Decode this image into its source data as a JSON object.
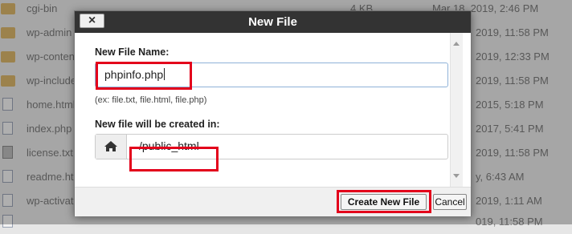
{
  "file_list": [
    {
      "name": "cgi-bin",
      "size": "4 KB",
      "date": "Mar 18, 2019, 2:46 PM",
      "type": "folder"
    },
    {
      "name": "wp-admin",
      "size": "",
      "date": "2019, 11:58 PM",
      "type": "folder"
    },
    {
      "name": "wp-content",
      "size": "",
      "date": "2019, 12:33 PM",
      "type": "folder"
    },
    {
      "name": "wp-includes",
      "size": "",
      "date": "2019, 11:58 PM",
      "type": "folder"
    },
    {
      "name": "home.html",
      "size": "",
      "date": "2015, 5:18 PM",
      "type": "file"
    },
    {
      "name": "index.php",
      "size": "",
      "date": "2017, 5:41 PM",
      "type": "file"
    },
    {
      "name": "license.txt",
      "size": "",
      "date": "2019, 11:58 PM",
      "type": "file"
    },
    {
      "name": "readme.html",
      "size": "",
      "date": "y, 6:43 AM",
      "type": "file"
    },
    {
      "name": "wp-activate.php",
      "size": "",
      "date": "2019, 1:11 AM",
      "type": "file"
    },
    {
      "name": "",
      "size": "",
      "date": "019, 11:58 PM",
      "type": "file"
    }
  ],
  "dialog": {
    "title": "New File",
    "close_label": "×",
    "file_name_label": "New File Name:",
    "file_name_value": "phpinfo.php",
    "file_name_hint": "(ex: file.txt, file.html, file.php)",
    "location_label": "New file will be created in:",
    "location_value": "/public_html",
    "location_icon": "home-icon",
    "create_button": "Create New File",
    "cancel_button": "Cancel"
  },
  "colors": {
    "highlight_box": "#e3001b",
    "titlebar": "#333333",
    "folder": "#d9b56a"
  }
}
